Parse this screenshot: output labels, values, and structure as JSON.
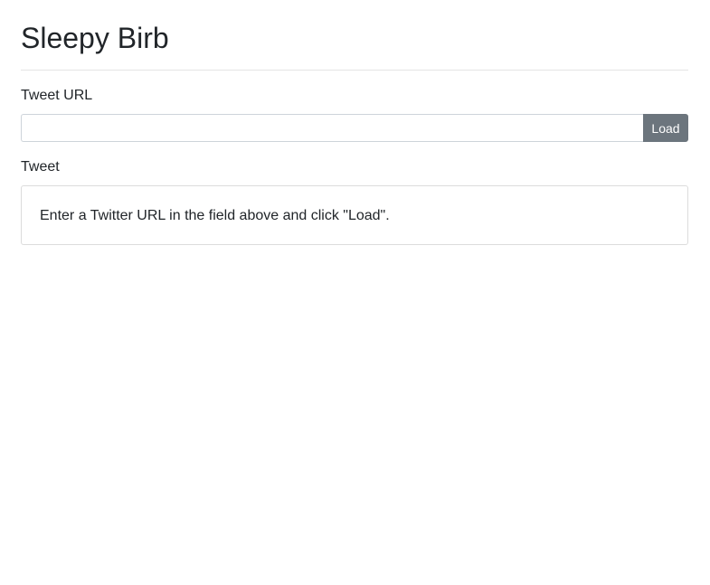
{
  "header": {
    "title": "Sleepy Birb"
  },
  "url_section": {
    "label": "Tweet URL",
    "input_value": "",
    "input_placeholder": "",
    "load_label": "Load"
  },
  "tweet_section": {
    "label": "Tweet",
    "message": "Enter a Twitter URL in the field above and click \"Load\"."
  },
  "colors": {
    "button_bg": "#6c757d",
    "text": "#212529",
    "border": "#ced4da"
  }
}
